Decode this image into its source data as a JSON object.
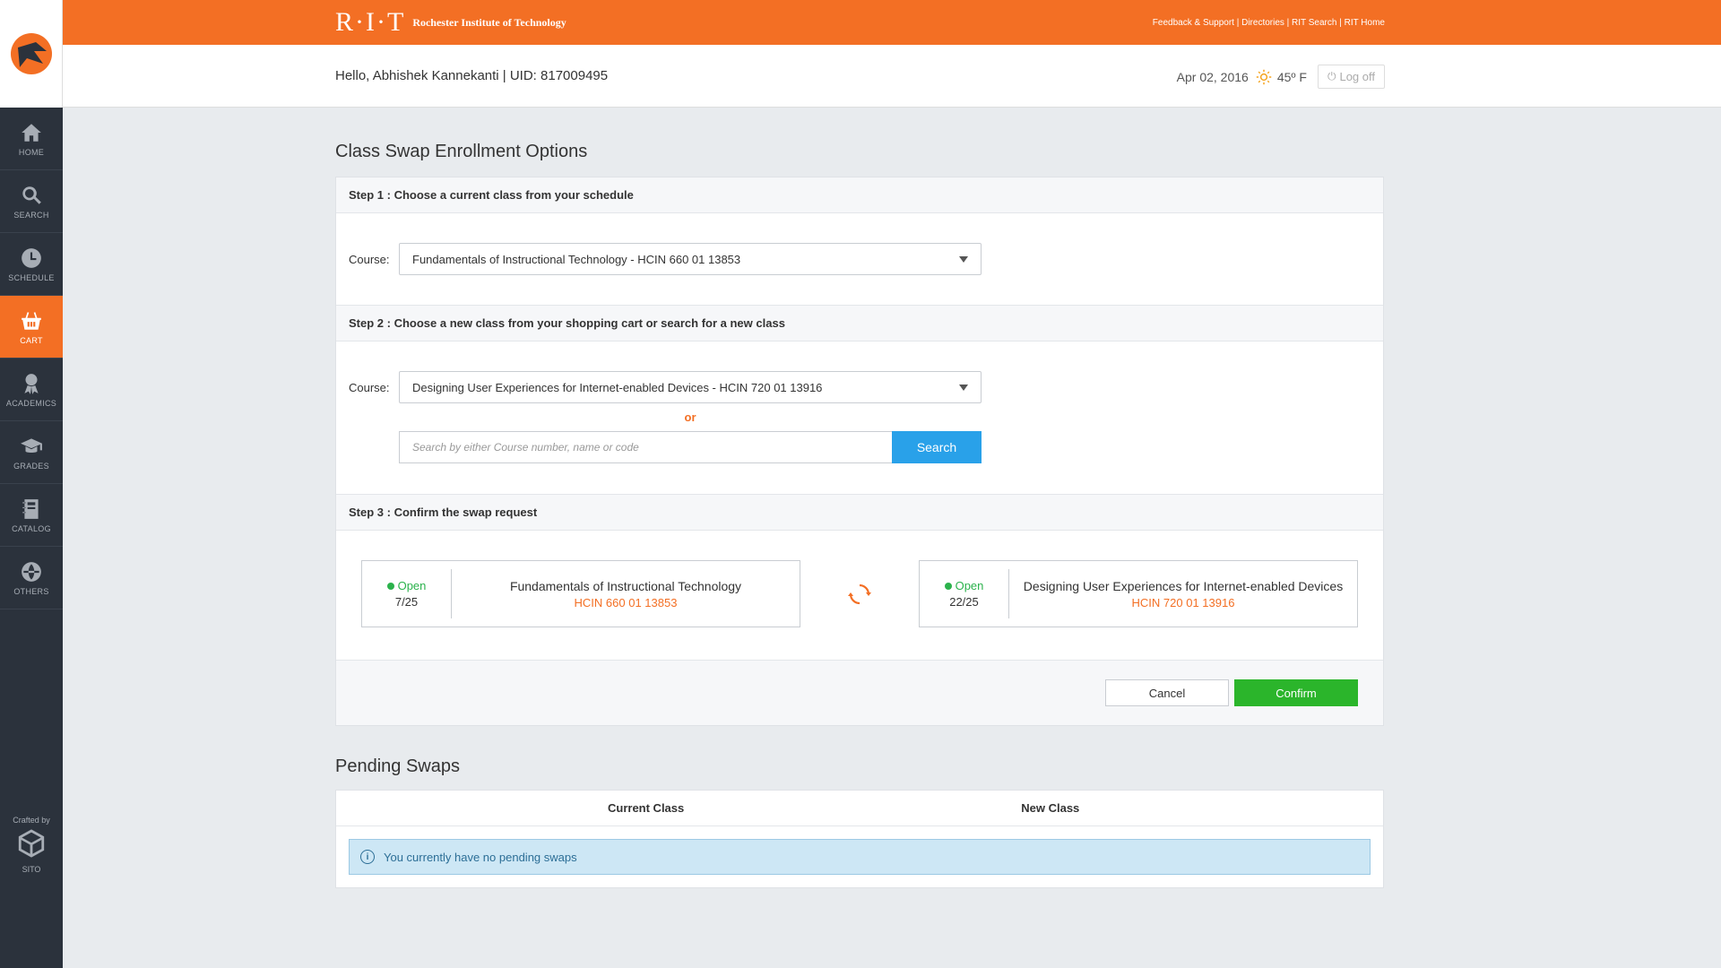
{
  "topbar": {
    "brand_mark": "R·I·T",
    "brand_name": "Rochester Institute of Technology",
    "links": "Feedback & Support | Directories | RIT Search | RIT Home"
  },
  "header": {
    "greeting": "Hello, Abhishek Kannekanti  |  UID: 817009495",
    "date": "Apr 02, 2016",
    "temperature": "45º F",
    "logoff": "Log off"
  },
  "sidebar": {
    "items": [
      {
        "label": "HOME",
        "icon": "home-icon"
      },
      {
        "label": "SEARCH",
        "icon": "search-icon"
      },
      {
        "label": "SCHEDULE",
        "icon": "clock-icon"
      },
      {
        "label": "CART",
        "icon": "basket-icon"
      },
      {
        "label": "ACADEMICS",
        "icon": "ribbon-icon"
      },
      {
        "label": "GRADES",
        "icon": "graduation-cap-icon"
      },
      {
        "label": "CATALOG",
        "icon": "book-icon"
      },
      {
        "label": "OTHERS",
        "icon": "globe-icon"
      }
    ],
    "crafted_by": "Crafted by",
    "crafted_name": "SITO"
  },
  "main": {
    "title": "Class Swap Enrollment Options",
    "step1": {
      "heading": "Step 1 : Choose a current class from your schedule",
      "label": "Course:",
      "selected": "Fundamentals of Instructional Technology - HCIN 660 01 13853"
    },
    "step2": {
      "heading": "Step 2 : Choose a new class from your shopping cart or search for a new class",
      "label": "Course:",
      "selected": "Designing User Experiences for Internet-enabled Devices - HCIN 720 01 13916",
      "or": "or",
      "search_placeholder": "Search by either Course number, name or code",
      "search_button": "Search"
    },
    "step3": {
      "heading": "Step 3 : Confirm the swap request",
      "current": {
        "status": "Open",
        "seats": "7/25",
        "name": "Fundamentals of Instructional Technology",
        "code": "HCIN 660 01 13853"
      },
      "new": {
        "status": "Open",
        "seats": "22/25",
        "name": "Designing User Experiences for Internet-enabled Devices",
        "code": "HCIN 720 01 13916"
      }
    },
    "actions": {
      "cancel": "Cancel",
      "confirm": "Confirm"
    },
    "pending": {
      "title": "Pending Swaps",
      "col_current": "Current Class",
      "col_new": "New Class",
      "empty_message": "You currently have no pending swaps"
    }
  },
  "colors": {
    "brand": "#f36f24",
    "sidebar": "#2b323c",
    "confirm": "#2bb52b",
    "search": "#29a1e9",
    "open": "#2bb24c"
  }
}
